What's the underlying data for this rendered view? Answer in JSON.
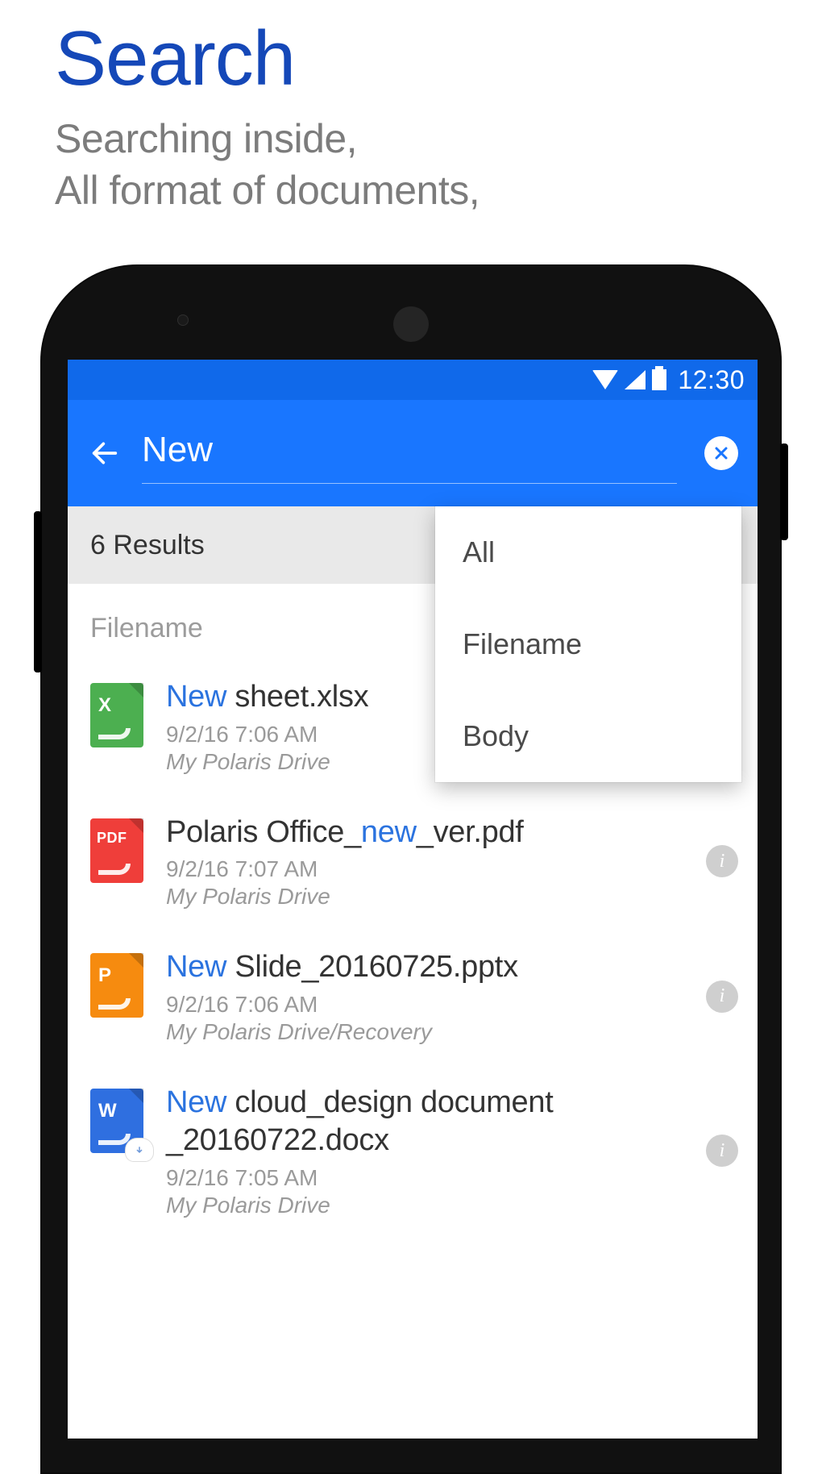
{
  "promo": {
    "title": "Search",
    "line1": "Searching inside,",
    "line2": "All format of documents,"
  },
  "statusbar": {
    "time": "12:30"
  },
  "search": {
    "query": "New",
    "results_label": "6 Results",
    "section_label": "Filename"
  },
  "filter_options": [
    {
      "label": "All"
    },
    {
      "label": "Filename"
    },
    {
      "label": "Body"
    }
  ],
  "files": [
    {
      "type": "xlsx",
      "icon_label": "X",
      "title_prefix_hl": "New",
      "title_rest": " sheet.xlsx",
      "date": "9/2/16 7:06 AM",
      "location": "My Polaris Drive",
      "show_info": false,
      "cloud_badge": false
    },
    {
      "type": "pdf",
      "icon_label": "PDF",
      "title_prefix": "Polaris Office_",
      "title_mid_hl": "new",
      "title_suffix": "_ver.pdf",
      "date": "9/2/16 7:07 AM",
      "location": "My Polaris Drive",
      "show_info": true,
      "cloud_badge": false
    },
    {
      "type": "pptx",
      "icon_label": "P",
      "title_prefix_hl": "New",
      "title_rest": " Slide_20160725.pptx",
      "date": "9/2/16 7:06 AM",
      "location": "My Polaris Drive/Recovery",
      "show_info": true,
      "cloud_badge": false
    },
    {
      "type": "docx",
      "icon_label": "W",
      "title_prefix_hl": "New",
      "title_rest": " cloud_design document _20160722.docx",
      "date": "9/2/16 7:05 AM",
      "location": "My Polaris Drive",
      "show_info": true,
      "cloud_badge": true
    }
  ],
  "info_glyph": "i"
}
